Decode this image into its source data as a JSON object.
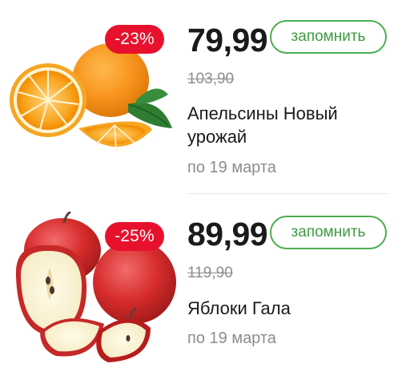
{
  "products": [
    {
      "discount": "-23%",
      "price": "79,99",
      "old_price": "103,90",
      "name": "Апельсины Новый урожай",
      "validity": "по 19 марта",
      "remember_label": "запомнить",
      "image_icon": "orange-fruit-image"
    },
    {
      "discount": "-25%",
      "price": "89,99",
      "old_price": "119,90",
      "name": "Яблоки Гала",
      "validity": "по 19 марта",
      "remember_label": "запомнить",
      "image_icon": "apple-fruit-image"
    }
  ],
  "colors": {
    "badge": "#e8112d",
    "button_border": "#4cae4f",
    "button_text": "#3d9b40",
    "muted_text": "#8c8c8c"
  }
}
